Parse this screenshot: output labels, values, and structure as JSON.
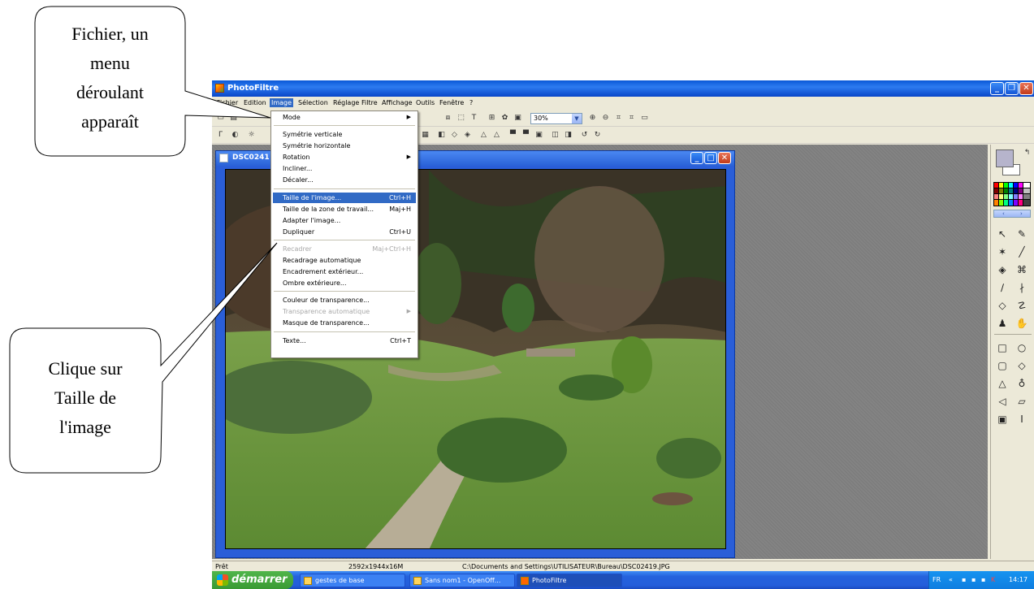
{
  "app": {
    "title": "PhotoFiltre",
    "window_buttons": [
      "_",
      "❐",
      "✕"
    ]
  },
  "menubar": {
    "items": [
      "Fichier",
      "Edition",
      "Image",
      "Sélection",
      "Réglage",
      "Filtre",
      "Affichage",
      "Outils",
      "Fenêtre",
      "?"
    ],
    "active": "Image"
  },
  "toolbar": {
    "zoom_value": "30%"
  },
  "document": {
    "title": "DSC0241"
  },
  "image_menu": {
    "items": [
      {
        "label": "Mode",
        "shortcut": "",
        "submenu": true,
        "state": "normal"
      },
      {
        "label": "Symétrie verticale",
        "shortcut": "",
        "submenu": false,
        "state": "normal"
      },
      {
        "label": "Symétrie horizontale",
        "shortcut": "",
        "submenu": false,
        "state": "normal"
      },
      {
        "label": "Rotation",
        "shortcut": "",
        "submenu": true,
        "state": "normal"
      },
      {
        "label": "Incliner...",
        "shortcut": "",
        "submenu": false,
        "state": "normal"
      },
      {
        "label": "Décaler...",
        "shortcut": "",
        "submenu": false,
        "state": "normal"
      },
      {
        "label": "Taille de l'image...",
        "shortcut": "Ctrl+H",
        "submenu": false,
        "state": "highlighted"
      },
      {
        "label": "Taille de la zone de travail...",
        "shortcut": "Maj+H",
        "submenu": false,
        "state": "normal"
      },
      {
        "label": "Adapter l'image...",
        "shortcut": "",
        "submenu": false,
        "state": "normal"
      },
      {
        "label": "Dupliquer",
        "shortcut": "Ctrl+U",
        "submenu": false,
        "state": "normal"
      },
      {
        "label": "Recadrer",
        "shortcut": "Maj+Ctrl+H",
        "submenu": false,
        "state": "disabled"
      },
      {
        "label": "Recadrage automatique",
        "shortcut": "",
        "submenu": false,
        "state": "normal"
      },
      {
        "label": "Encadrement extérieur...",
        "shortcut": "",
        "submenu": false,
        "state": "normal"
      },
      {
        "label": "Ombre extérieure...",
        "shortcut": "",
        "submenu": false,
        "state": "normal"
      },
      {
        "label": "Couleur de transparence...",
        "shortcut": "",
        "submenu": false,
        "state": "normal"
      },
      {
        "label": "Transparence automatique",
        "shortcut": "",
        "submenu": true,
        "state": "disabled"
      },
      {
        "label": "Masque de transparence...",
        "shortcut": "",
        "submenu": false,
        "state": "normal"
      },
      {
        "label": "Texte...",
        "shortcut": "Ctrl+T",
        "submenu": false,
        "state": "normal"
      }
    ]
  },
  "statusbar": {
    "status": "Prêt",
    "dimensions": "2592x1944x16M",
    "path": "C:\\Documents and Settings\\UTILISATEUR\\Bureau\\DSC02419.JPG"
  },
  "taskbar": {
    "start_label": "démarrer",
    "tasks": [
      "gestes de base",
      "Sans nom1 - OpenOff...",
      "PhotoFiltre"
    ],
    "language": "FR",
    "clock": "14:17"
  },
  "callouts": {
    "top": [
      "Fichier, un",
      "menu",
      "déroulant",
      "apparaît"
    ],
    "bottom": [
      "Clique sur",
      "Taille de",
      "l'image"
    ]
  },
  "colors": {
    "xp_blue": "#2462dc",
    "menu_highlight": "#316ac5",
    "start_green": "#3a9a34"
  }
}
